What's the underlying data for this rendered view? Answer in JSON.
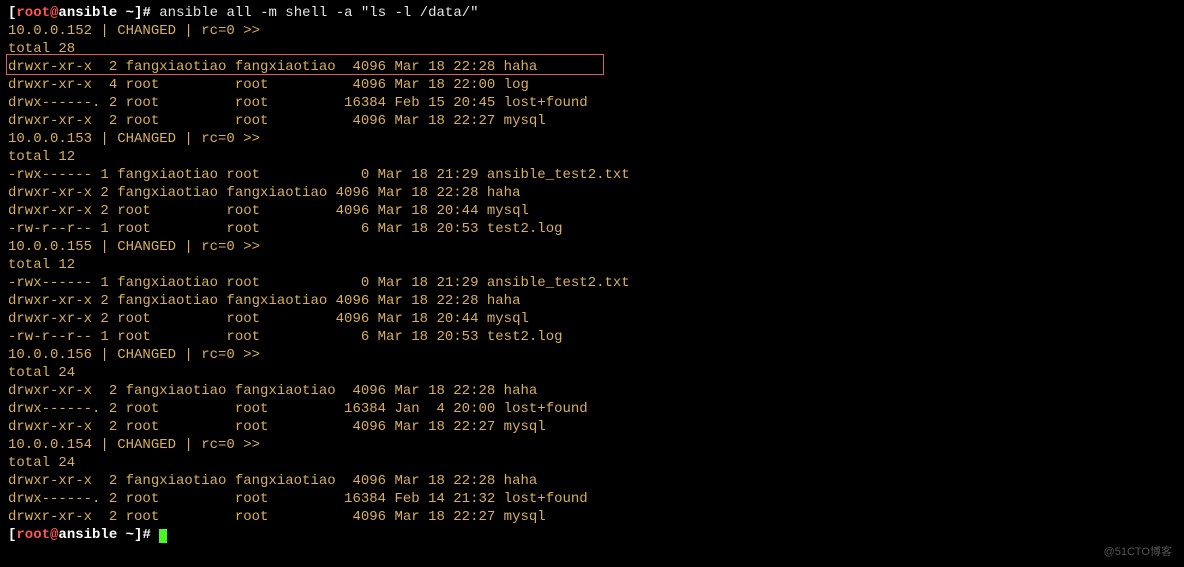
{
  "prompt1": {
    "bracket_open": "[",
    "user": "root",
    "at": "@",
    "host": "ansible",
    "path": " ~",
    "bracket_close": "]",
    "hash": "# ",
    "command": "ansible all -m shell -a \"ls -l /data/\""
  },
  "hosts": [
    {
      "header": "10.0.0.152 | CHANGED | rc=0 >>",
      "total": "total 28",
      "rows": [
        "drwxr-xr-x  2 fangxiaotiao fangxiaotiao  4096 Mar 18 22:28 haha",
        "drwxr-xr-x  4 root         root          4096 Mar 18 22:00 log",
        "drwx------. 2 root         root         16384 Feb 15 20:45 lost+found",
        "drwxr-xr-x  2 root         root          4096 Mar 18 22:27 mysql"
      ]
    },
    {
      "header": "10.0.0.153 | CHANGED | rc=0 >>",
      "total": "total 12",
      "rows": [
        "-rwx------ 1 fangxiaotiao root            0 Mar 18 21:29 ansible_test2.txt",
        "drwxr-xr-x 2 fangxiaotiao fangxiaotiao 4096 Mar 18 22:28 haha",
        "drwxr-xr-x 2 root         root         4096 Mar 18 20:44 mysql",
        "-rw-r--r-- 1 root         root            6 Mar 18 20:53 test2.log"
      ]
    },
    {
      "header": "10.0.0.155 | CHANGED | rc=0 >>",
      "total": "total 12",
      "rows": [
        "-rwx------ 1 fangxiaotiao root            0 Mar 18 21:29 ansible_test2.txt",
        "drwxr-xr-x 2 fangxiaotiao fangxiaotiao 4096 Mar 18 22:28 haha",
        "drwxr-xr-x 2 root         root         4096 Mar 18 20:44 mysql",
        "-rw-r--r-- 1 root         root            6 Mar 18 20:53 test2.log"
      ]
    },
    {
      "header": "10.0.0.156 | CHANGED | rc=0 >>",
      "total": "total 24",
      "rows": [
        "drwxr-xr-x  2 fangxiaotiao fangxiaotiao  4096 Mar 18 22:28 haha",
        "drwx------. 2 root         root         16384 Jan  4 20:00 lost+found",
        "drwxr-xr-x  2 root         root          4096 Mar 18 22:27 mysql"
      ]
    },
    {
      "header": "10.0.0.154 | CHANGED | rc=0 >>",
      "total": "total 24",
      "rows": [
        "drwxr-xr-x  2 fangxiaotiao fangxiaotiao  4096 Mar 18 22:28 haha",
        "drwx------. 2 root         root         16384 Feb 14 21:32 lost+found",
        "drwxr-xr-x  2 root         root          4096 Mar 18 22:27 mysql"
      ]
    }
  ],
  "prompt2": {
    "bracket_open": "[",
    "user": "root",
    "at": "@",
    "host": "ansible",
    "path": " ~",
    "bracket_close": "]",
    "hash": "# "
  },
  "watermark": "@51CTO博客"
}
